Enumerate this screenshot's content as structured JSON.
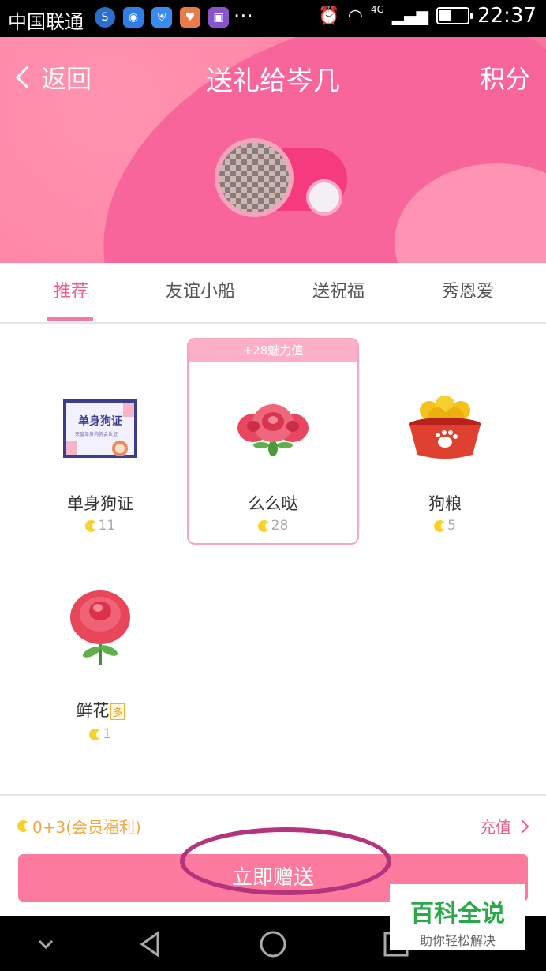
{
  "status_bar": {
    "carrier": "中国联通",
    "network": "4G",
    "time": "22:37",
    "more": "···"
  },
  "header": {
    "back_label": "返回",
    "title": "送礼给岑几",
    "points_label": "积分"
  },
  "tabs": [
    {
      "label": "推荐",
      "active": true
    },
    {
      "label": "友谊小船",
      "active": false
    },
    {
      "label": "送祝福",
      "active": false
    },
    {
      "label": "秀恩爱",
      "active": false
    }
  ],
  "gifts": [
    {
      "name": "单身狗证",
      "price": "11",
      "icon": "single-dog-certificate-icon"
    },
    {
      "name": "么么哒",
      "price": "28",
      "banner": "+28魅力值",
      "selected": true,
      "icon": "pink-rose-bouquet-icon"
    },
    {
      "name": "狗粮",
      "price": "5",
      "icon": "dog-food-bowl-icon"
    },
    {
      "name": "鲜花",
      "price": "1",
      "badge": "多",
      "icon": "red-rose-icon"
    },
    {
      "certificate_text": "单身狗证",
      "certificate_sub": "天皇单身狗协会认证"
    }
  ],
  "footer": {
    "balance": "0+3(会员福利)",
    "recharge_label": "充值",
    "send_label": "立即赠送"
  },
  "watermark": {
    "title": "百科全说",
    "subtitle": "助你轻松解决"
  },
  "colors": {
    "accent": "#f05c86",
    "header_pink": "#ff86a6",
    "button_pink": "#fb7a9d",
    "coin_yellow": "#f6d22b"
  }
}
